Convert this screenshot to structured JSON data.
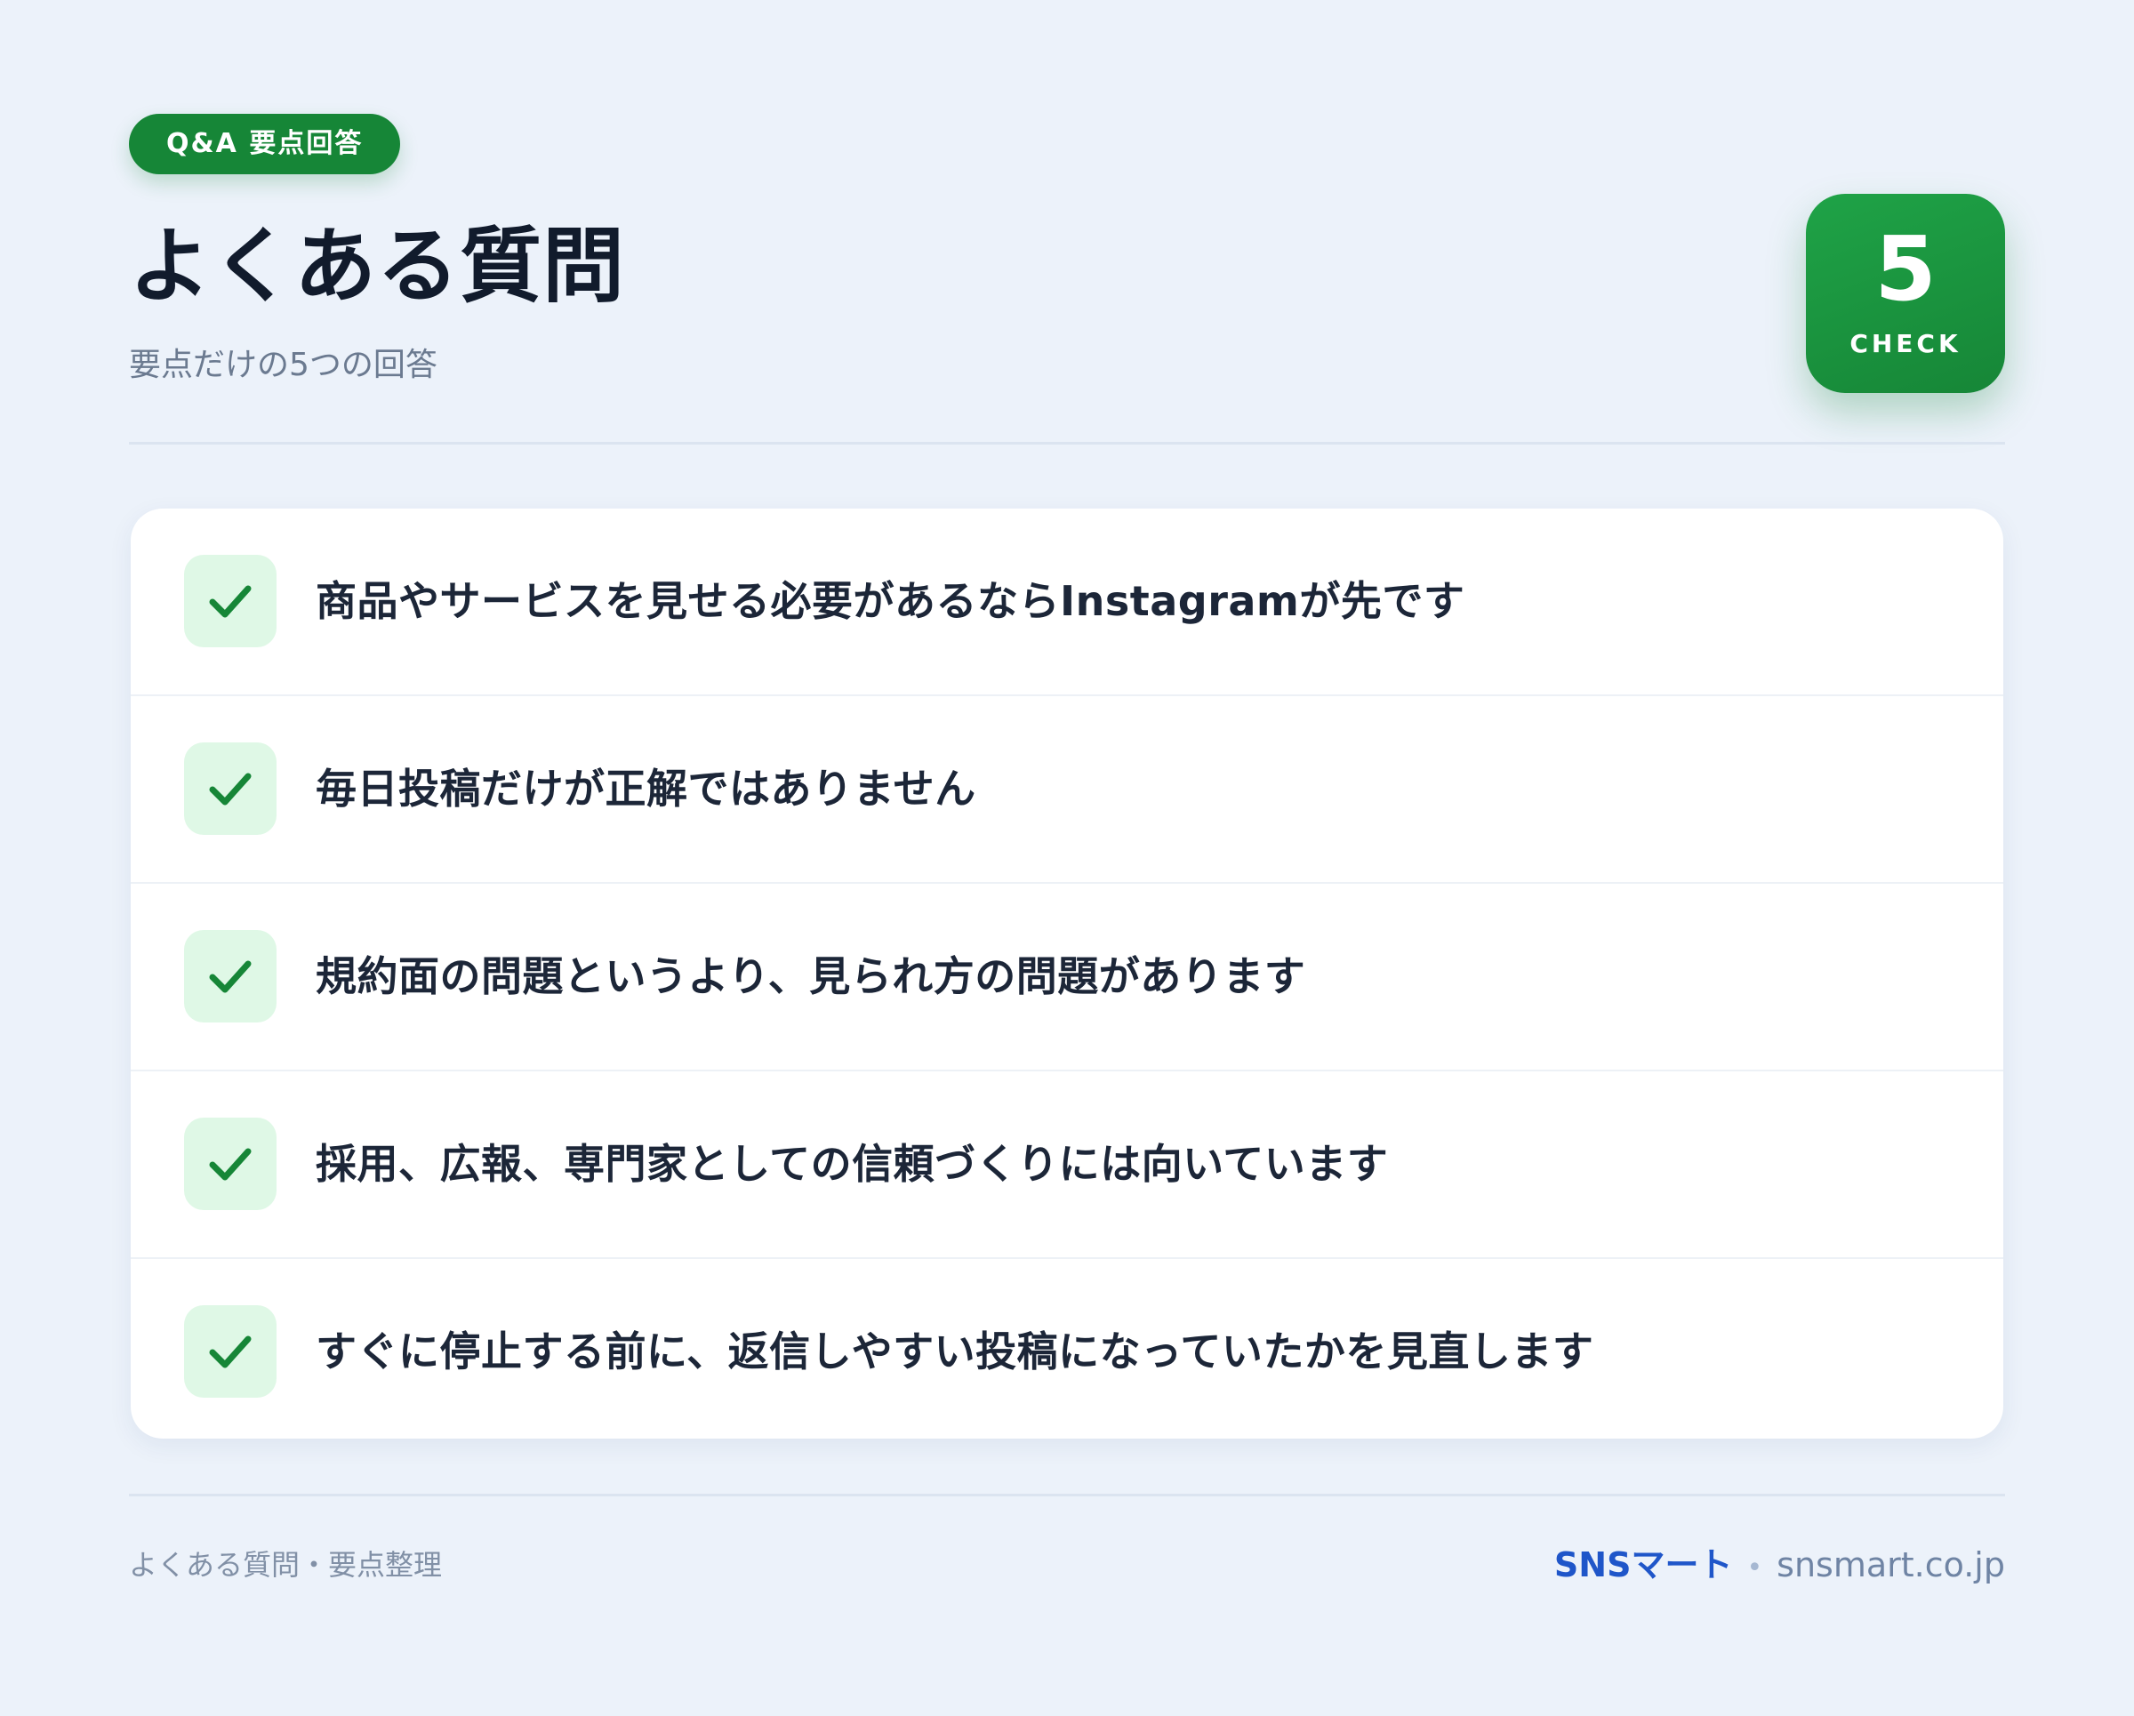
{
  "header": {
    "pill_label": "Q&A 要点回答",
    "title": "よくある質問",
    "subtitle": "要点だけの5つの回答"
  },
  "badge": {
    "count": "5",
    "label": "CHECK"
  },
  "items": [
    {
      "text": "商品やサービスを見せる必要があるならInstagramが先です",
      "icon": "check-icon"
    },
    {
      "text": "毎日投稿だけが正解ではありません",
      "icon": "check-icon"
    },
    {
      "text": "規約面の問題というより、見られ方の問題があります",
      "icon": "check-icon"
    },
    {
      "text": "採用、広報、専門家としての信頼づくりには向いています",
      "icon": "check-icon"
    },
    {
      "text": "すぐに停止する前に、返信しやすい投稿になっていたかを見直します",
      "icon": "check-icon"
    }
  ],
  "footer": {
    "left": "よくある質問・要点整理",
    "brand": "SNSマート",
    "separator": "•",
    "domain": "snsmart.co.jp"
  },
  "colors": {
    "background": "#ecf2fa",
    "accent_green": "#168637",
    "check_bg": "#dff8e6",
    "brand_blue": "#1f56c9"
  }
}
